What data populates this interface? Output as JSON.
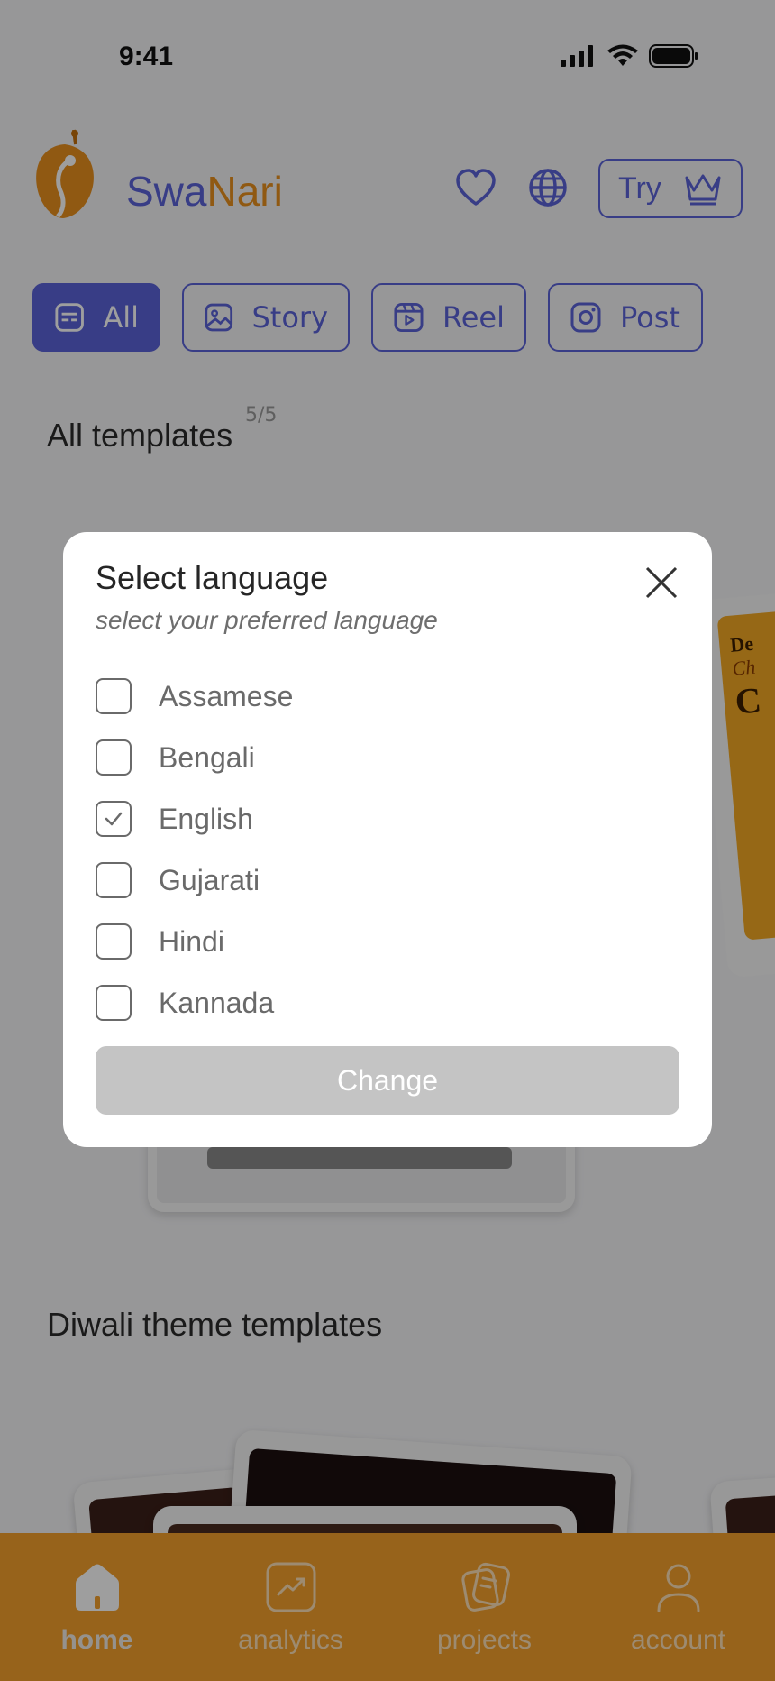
{
  "status_bar": {
    "time": "9:41"
  },
  "header": {
    "brand_part1": "Swa",
    "brand_part2": "Nari",
    "try_label": "Try",
    "colors": {
      "primary": "#5b63d8",
      "accent": "#e8901e"
    },
    "icons": [
      "heart-icon",
      "globe-icon",
      "crown-icon"
    ]
  },
  "filters": [
    {
      "label": "All",
      "icon": "template-icon",
      "active": true
    },
    {
      "label": "Story",
      "icon": "image-icon",
      "active": false
    },
    {
      "label": "Reel",
      "icon": "reel-icon",
      "active": false
    },
    {
      "label": "Post",
      "icon": "instagram-icon",
      "active": false
    }
  ],
  "sections": {
    "all_templates": {
      "title": "All templates",
      "counter": "5/5"
    },
    "diwali": {
      "title": "Diwali theme templates"
    }
  },
  "background_card": {
    "text_line1": "De",
    "text_line2": "Ch",
    "text_line3": "C"
  },
  "modal": {
    "title": "Select language",
    "subtitle": "select your preferred language",
    "options": [
      {
        "label": "Assamese",
        "checked": false
      },
      {
        "label": "Bengali",
        "checked": false
      },
      {
        "label": "English",
        "checked": true
      },
      {
        "label": "Gujarati",
        "checked": false
      },
      {
        "label": "Hindi",
        "checked": false
      },
      {
        "label": "Kannada",
        "checked": false
      }
    ],
    "button_label": "Change"
  },
  "bottom_nav": [
    {
      "label": "home",
      "icon": "home-icon",
      "active": true
    },
    {
      "label": "analytics",
      "icon": "analytics-icon",
      "active": false
    },
    {
      "label": "projects",
      "icon": "projects-icon",
      "active": false
    },
    {
      "label": "account",
      "icon": "account-icon",
      "active": false
    }
  ]
}
